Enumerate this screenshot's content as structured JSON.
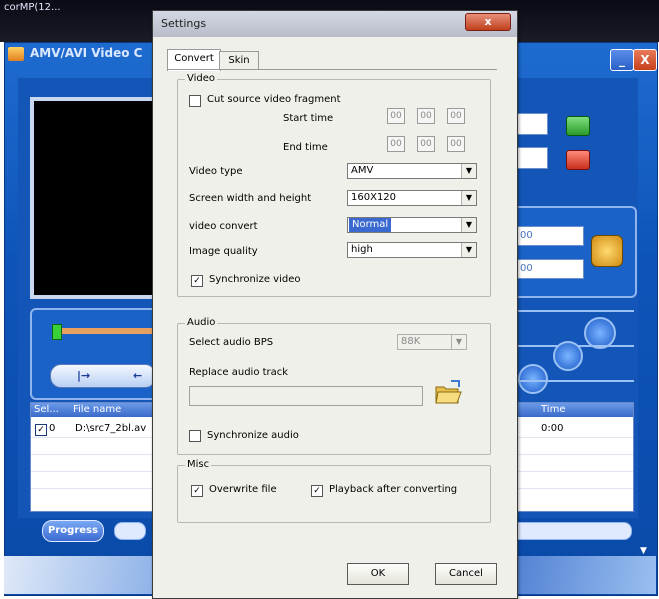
{
  "app": {
    "window_title": "corMP(12...",
    "title": "AMV/AVI Video C",
    "min_label": "_",
    "close_label": "X",
    "field_right_1": "00",
    "field_right_2": "00",
    "nav_arrow_forward": "|→",
    "nav_arrow_back": "←",
    "table": {
      "columns": [
        "Sel...",
        "File name",
        "Time"
      ],
      "rows": [
        {
          "checked": true,
          "sel": "0",
          "file": "D:\\src7_2bl.av",
          "time": "0:00"
        }
      ]
    },
    "progress_label": "Progress"
  },
  "dialog": {
    "title": "Settings",
    "close_label": "x",
    "tabs": [
      "Convert",
      "Skin"
    ],
    "active_tab": "Convert",
    "video": {
      "group_label": "Video",
      "cut_fragment_label": "Cut source video fragment",
      "cut_fragment_checked": false,
      "start_time_label": "Start time",
      "end_time_label": "End time",
      "start_time": [
        "00",
        "00",
        "00"
      ],
      "end_time": [
        "00",
        "00",
        "00"
      ],
      "video_type_label": "Video type",
      "video_type_value": "AMV",
      "screen_size_label": "Screen width and height",
      "screen_size_value": "160X120",
      "video_convert_label": "video convert",
      "video_convert_value": "Normal",
      "image_quality_label": "Image quality",
      "image_quality_value": "high",
      "sync_video_label": "Synchronize video",
      "sync_video_checked": true
    },
    "audio": {
      "group_label": "Audio",
      "bps_label": "Select audio BPS",
      "bps_value": "88K",
      "replace_track_label": "Replace audio track",
      "sync_audio_label": "Synchronize audio",
      "sync_audio_checked": false
    },
    "misc": {
      "group_label": "Misc",
      "overwrite_label": "Overwrite file",
      "overwrite_checked": true,
      "playback_label": "Playback after converting",
      "playback_checked": true
    },
    "ok_label": "OK",
    "cancel_label": "Cancel"
  },
  "colors": {
    "app_blue": "#1356b8",
    "highlight": "#3a6ad0",
    "dialog_bg": "#f0f0ea"
  }
}
